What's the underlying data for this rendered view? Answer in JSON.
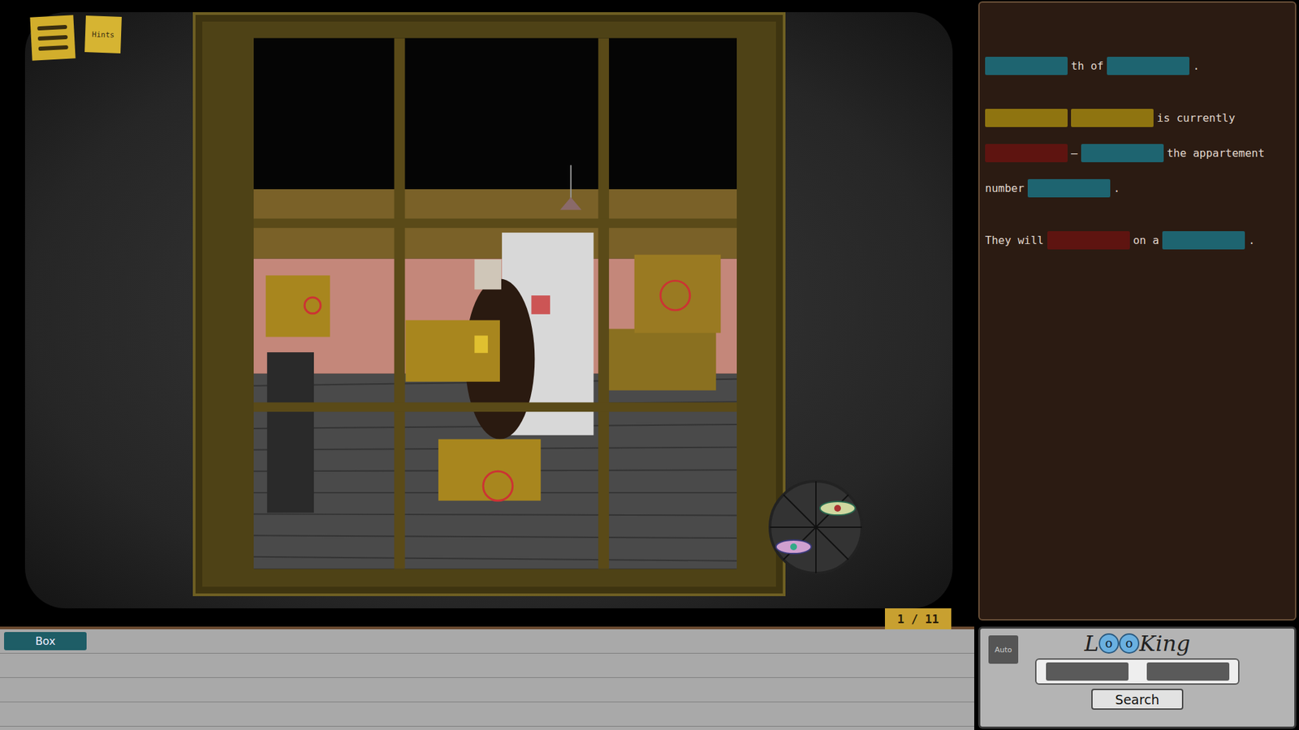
{
  "hints_button": {
    "label": "Hints"
  },
  "counter": "1 / 11",
  "words": [
    {
      "label": "Box",
      "selected": true
    }
  ],
  "notes": {
    "paragraphs": [
      [
        [
          {
            "kind": "blank",
            "color": "#1e6470"
          },
          {
            "kind": "text",
            "text": "th of"
          },
          {
            "kind": "blank",
            "color": "#1e6470"
          },
          {
            "kind": "text",
            "text": "."
          }
        ]
      ],
      [
        [
          {
            "kind": "blank",
            "color": "#8f7410"
          },
          {
            "kind": "blank",
            "color": "#8f7410"
          },
          {
            "kind": "text",
            "text": "is currently"
          }
        ],
        [
          {
            "kind": "blank",
            "color": "#5e1410"
          },
          {
            "kind": "text",
            "text": "–"
          },
          {
            "kind": "blank",
            "color": "#1e6470"
          },
          {
            "kind": "text",
            "text": "the appartement"
          }
        ],
        [
          {
            "kind": "text",
            "text": "number"
          },
          {
            "kind": "blank",
            "color": "#1e6470"
          },
          {
            "kind": "text",
            "text": "."
          }
        ]
      ],
      [
        [
          {
            "kind": "text",
            "text": "They will"
          },
          {
            "kind": "blank",
            "color": "#5e1410"
          },
          {
            "kind": "text",
            "text": "on a"
          },
          {
            "kind": "blank",
            "color": "#1e6470"
          },
          {
            "kind": "text",
            "text": "."
          }
        ]
      ]
    ]
  },
  "controls": {
    "auto": {
      "label": "Auto",
      "on": false
    },
    "logo": "LooKing",
    "slots": [
      {
        "filled": false
      },
      {
        "filled": false
      }
    ],
    "search": "Search"
  }
}
